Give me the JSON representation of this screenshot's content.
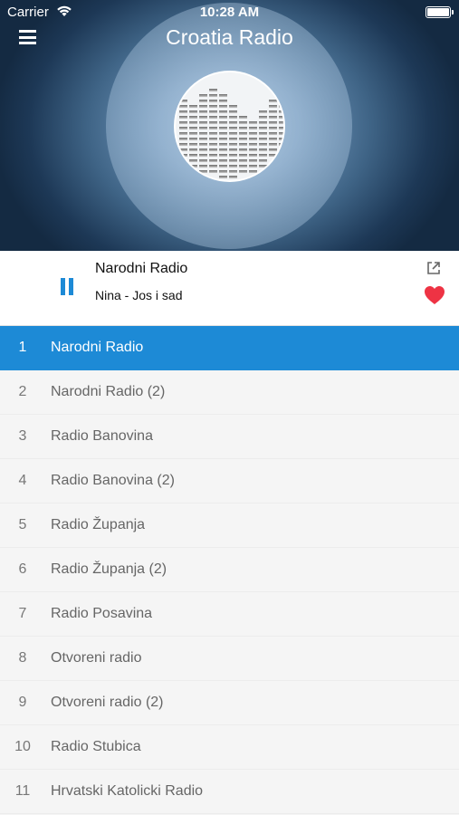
{
  "status_bar": {
    "carrier": "Carrier",
    "time": "10:28 AM"
  },
  "header": {
    "title": "Croatia Radio",
    "menu_icon": "hamburger-menu-icon",
    "logo_icon": "equalizer-logo-icon"
  },
  "player": {
    "station": "Narodni Radio",
    "track": "Nina - Jos i sad",
    "state": "playing",
    "pause_icon": "pause-icon",
    "share_icon": "share-external-icon",
    "favorite_icon": "heart-icon",
    "favorite_color": "#ee3344"
  },
  "colors": {
    "accent": "#1d8ad6",
    "list_bg": "#f5f5f5",
    "text_gray": "#666666"
  },
  "stations": [
    {
      "num": "1",
      "name": "Narodni Radio",
      "active": true
    },
    {
      "num": "2",
      "name": "Narodni Radio (2)"
    },
    {
      "num": "3",
      "name": "Radio Banovina"
    },
    {
      "num": "4",
      "name": "Radio Banovina (2)"
    },
    {
      "num": "5",
      "name": "Radio Županja"
    },
    {
      "num": "6",
      "name": "Radio Županja (2)"
    },
    {
      "num": "7",
      "name": "Radio Posavina"
    },
    {
      "num": "8",
      "name": "Otvoreni radio"
    },
    {
      "num": "9",
      "name": "Otvoreni radio (2)"
    },
    {
      "num": "10",
      "name": "Radio Stubica"
    },
    {
      "num": "11",
      "name": "Hrvatski Katolicki Radio"
    }
  ]
}
